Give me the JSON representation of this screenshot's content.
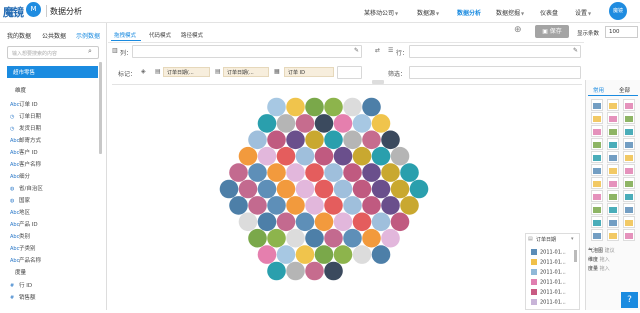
{
  "topbar": {
    "logo_text": "魔镜",
    "logo_mark": "M",
    "title": "数据分析",
    "nav": [
      {
        "label": "某移动公司"
      },
      {
        "label": "数据源"
      },
      {
        "label": "数据分析"
      },
      {
        "label": "数据挖掘"
      },
      {
        "label": "仪表盘"
      },
      {
        "label": "设置"
      }
    ],
    "user": "魔镜"
  },
  "sidebar": {
    "tabs": [
      "我的数据",
      "公共数据",
      "示例数据"
    ],
    "search_placeholder": "输入想要搜索的内容",
    "dataset": "超市零售",
    "dim_header": "维度",
    "dimensions": [
      {
        "label": "订单 ID",
        "type": "Abc"
      },
      {
        "label": "订单日期",
        "type": "日"
      },
      {
        "label": "发货日期",
        "type": "日"
      },
      {
        "label": "邮寄方式",
        "type": "Abc"
      },
      {
        "label": "客户 ID",
        "type": "Abc"
      },
      {
        "label": "客户名称",
        "type": "Abc"
      },
      {
        "label": "细分",
        "type": "Abc"
      },
      {
        "label": "省/自治区",
        "type": "地"
      },
      {
        "label": "国家",
        "type": "地"
      },
      {
        "label": "地区",
        "type": "Abc"
      },
      {
        "label": "产品 ID",
        "type": "Abc"
      },
      {
        "label": "类别",
        "type": "Abc"
      },
      {
        "label": "子类别",
        "type": "Abc"
      },
      {
        "label": "产品名称",
        "type": "Abc"
      }
    ],
    "meas_header": "度量",
    "measures": [
      {
        "label": "行 ID",
        "type": "#"
      },
      {
        "label": "销售额",
        "type": "#"
      }
    ]
  },
  "main": {
    "tabs": [
      "拖拽模式",
      "代码模式",
      "路径模式"
    ],
    "columns_label": "列：",
    "rows_label": "行：",
    "marks_label": "标记：",
    "filter_label": "筛选：",
    "marks_pills": [
      "订单日期(...",
      "订单日期(...",
      "订单 ID"
    ],
    "zoom_icon": "zoom-in-icon",
    "save_label": "保存",
    "rows_count_label": "显示条数",
    "rows_count_value": "100"
  },
  "legend": {
    "title": "订单日期",
    "items": [
      {
        "label": "2011-01...",
        "color": "#5b8db8"
      },
      {
        "label": "2011-01...",
        "color": "#f0c04a"
      },
      {
        "label": "2011-01...",
        "color": "#8fb8d8"
      },
      {
        "label": "2011-01...",
        "color": "#e07fb0"
      },
      {
        "label": "2011-01...",
        "color": "#c85a82"
      },
      {
        "label": "2011-01...",
        "color": "#c8b4d8"
      }
    ]
  },
  "right_panel": {
    "tabs": [
      "常用",
      "全部"
    ],
    "bubble_label": "气泡图",
    "bubble_sub": "建议",
    "hints": [
      {
        "label": "维度",
        "value": "拖入"
      },
      {
        "label": "度量",
        "value": "拖入"
      }
    ]
  },
  "bubble_colors": [
    "#a7c8e3",
    "#8db44c",
    "#c36a8f",
    "#e2b7dc",
    "#c05a80",
    "#2a9fad",
    "#3b4a5e",
    "#f0c44c",
    "#dcdcdc",
    "#5e8fb8",
    "#e45d5d",
    "#6a4f8c",
    "#b5b5b5",
    "#e57fae",
    "#7aa84a",
    "#4d7fa8",
    "#f29a3d",
    "#9fbfdc",
    "#c9a830",
    "#c66c8e"
  ],
  "bubble_count": 89,
  "help_label": "?"
}
